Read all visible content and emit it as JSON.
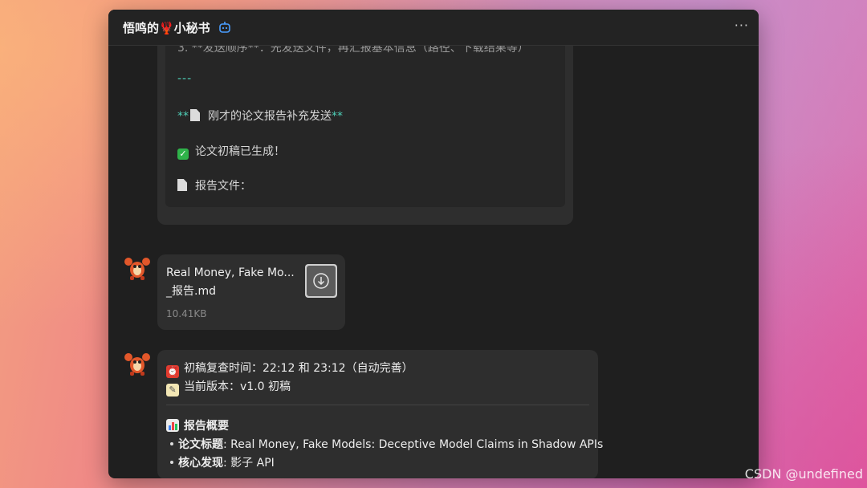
{
  "window": {
    "title": "悟鸣的🦞小秘书",
    "more_label": "···"
  },
  "message1": {
    "line_step": "3. **发送顺序**：先发送文件，再汇报基本信息（路径、下载结果等）",
    "divider": "---",
    "heading_prefix": "**",
    "heading_text": "刚才的论文报告补充发送",
    "heading_suffix": "**",
    "draft_done": "论文初稿已生成！",
    "report_file": "报告文件："
  },
  "file_card": {
    "name_line1": "Real Money, Fake Mo...",
    "name_line2": "_报告.md",
    "size": "10.41KB"
  },
  "message3": {
    "review_time": "初稿复查时间：22:12 和 23:12（自动完善）",
    "version": "当前版本：v1.0 初稿",
    "summary_title": "报告概要",
    "paper_title_label": "论文标题",
    "paper_title_value": ": Real Money, Fake Models: Deceptive Model Claims in Shadow APIs",
    "finding_label": "核心发现",
    "finding_value": ": 影子 API"
  },
  "watermark": "CSDN @undefined",
  "colors": {
    "window_bg": "#1f1f1f",
    "bubble_bg": "#2e2e2e",
    "accent_teal": "#4fd0b8",
    "check_green": "#2fb34a"
  },
  "icons": [
    "bot-icon",
    "more-icon",
    "check-icon",
    "document-icon",
    "download-icon",
    "alarm-clock-icon",
    "memo-icon",
    "bar-chart-icon",
    "lobster-avatar-icon"
  ]
}
